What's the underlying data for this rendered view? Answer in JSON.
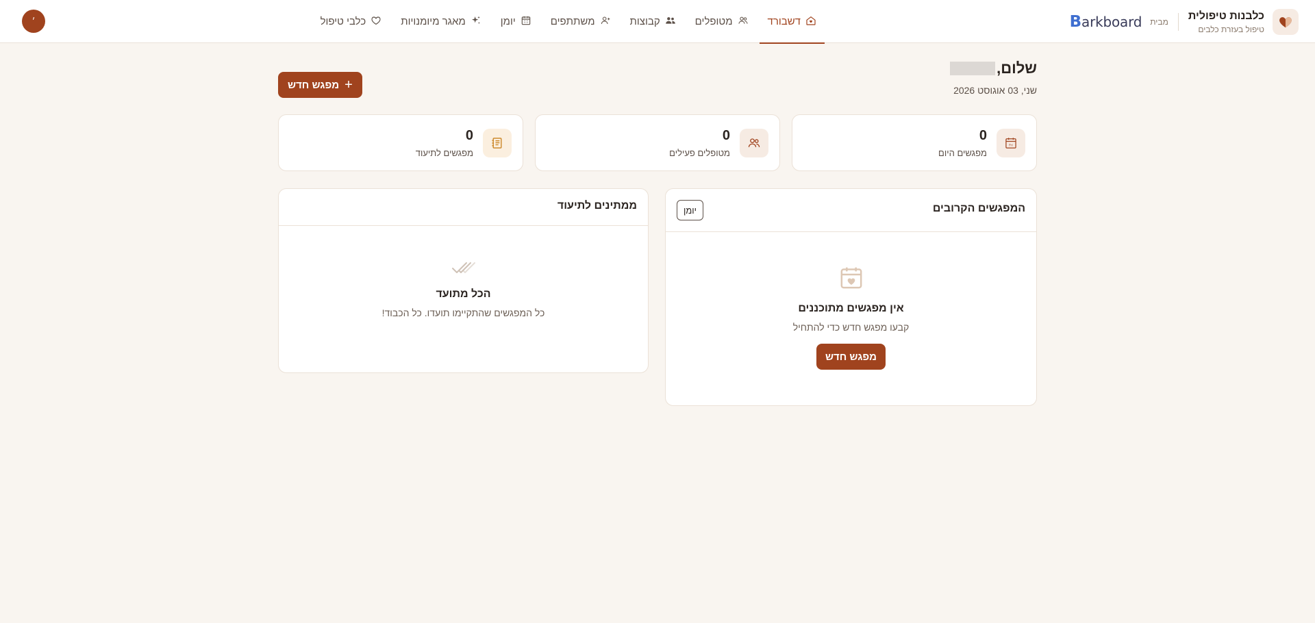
{
  "header": {
    "brand_name": "כלבנות טיפולית",
    "brand_tagline": "טיפול בעזרת כלבים",
    "partner_prefix": "מבית",
    "partner_logo_letter": "B",
    "partner_logo_rest": "arkboard",
    "avatar_initial": "׳",
    "nav": [
      {
        "label": "דשבורד",
        "icon": "home-heart-icon",
        "active": true
      },
      {
        "label": "מטופלים",
        "icon": "users-icon"
      },
      {
        "label": "קבוצות",
        "icon": "group-icon"
      },
      {
        "label": "משתתפים",
        "icon": "user-plus-icon"
      },
      {
        "label": "יומן",
        "icon": "calendar-grid-icon"
      },
      {
        "label": "מאגר מיומנויות",
        "icon": "sparkles-icon"
      },
      {
        "label": "כלבי טיפול",
        "icon": "heart-icon"
      }
    ]
  },
  "greeting": {
    "prefix": "שלום,",
    "date": "שני, 03 אוגוסט 2026"
  },
  "new_session_button": "מפגש חדש",
  "stats": [
    {
      "value": "0",
      "label": "מפגשים היום",
      "icon": "calendar-today-icon"
    },
    {
      "value": "0",
      "label": "מטופלים פעילים",
      "icon": "users-icon"
    },
    {
      "value": "0",
      "label": "מפגשים לתיעוד",
      "icon": "notebook-icon"
    }
  ],
  "upcoming": {
    "title": "המפגשים הקרובים",
    "calendar_button": "יומן",
    "empty_title": "אין מפגשים מתוכננים",
    "empty_sub": "קבעו מפגש חדש כדי להתחיל",
    "empty_button": "מפגש חדש",
    "icon": "calendar-heart-icon"
  },
  "pending": {
    "title": "ממתינים לתיעוד",
    "empty_title": "הכל מתועד",
    "empty_sub": "כל המפגשים שהתקיימו תועדו. כל הכבוד!",
    "icon": "double-check-icon"
  },
  "colors": {
    "accent": "#a0431e",
    "background": "#f9f5f0",
    "card_border": "#ebe1d7"
  }
}
